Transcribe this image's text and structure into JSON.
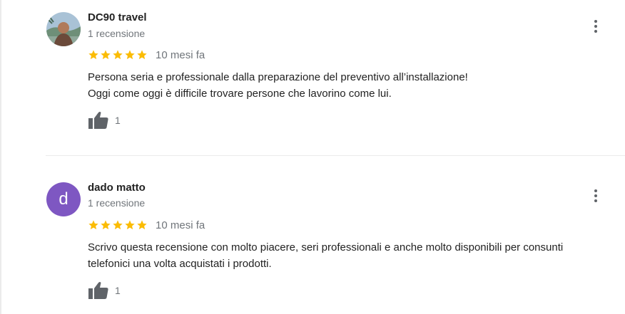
{
  "colors": {
    "star": "#fbbc04",
    "secondary_text": "#70757a",
    "avatar_bg": "#7e57c2",
    "divider": "#ebebeb",
    "icon": "#5f6368"
  },
  "reviews": [
    {
      "author": "DC90 travel",
      "avatar_type": "photo",
      "review_count": "1 recensione",
      "rating": 5,
      "date": "10 mesi fa",
      "text_lines": [
        "Persona seria e professionale dalla preparazione del preventivo all’installazione!",
        "Oggi come oggi è difficile trovare persone che lavorino come lui."
      ],
      "likes": "1",
      "icons": {
        "like": "thumbs-up-icon",
        "menu": "more-vert-icon"
      }
    },
    {
      "author": "dado matto",
      "avatar_type": "letter",
      "avatar_letter": "d",
      "review_count": "1 recensione",
      "rating": 5,
      "date": "10 mesi fa",
      "text_lines": [
        "Scrivo questa recensione con molto piacere, seri professionali e anche molto disponibili per consunti",
        "telefonici una volta acquistati i prodotti."
      ],
      "likes": "1",
      "icons": {
        "like": "thumbs-up-icon",
        "menu": "more-vert-icon"
      }
    }
  ]
}
